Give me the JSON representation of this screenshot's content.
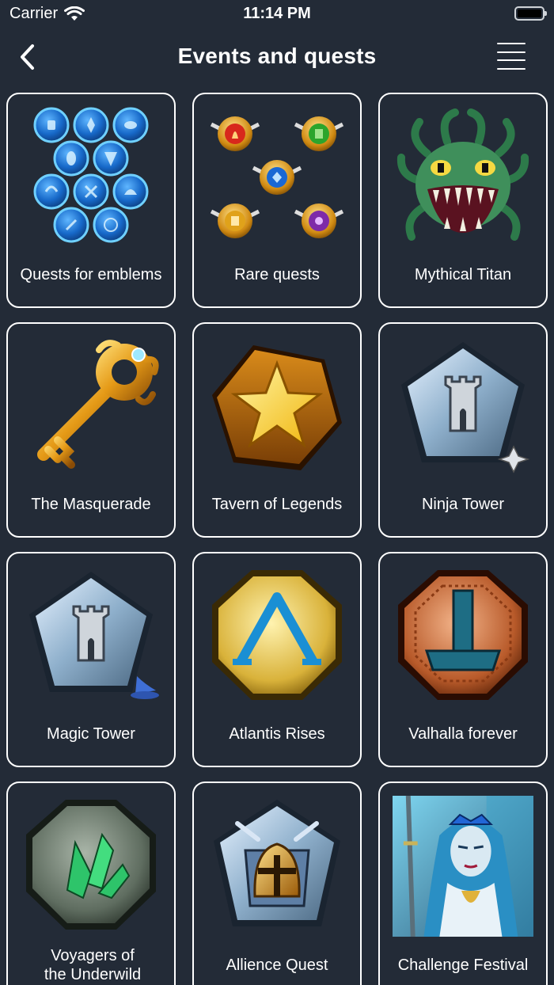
{
  "status": {
    "carrier": "Carrier",
    "time": "11:14 PM"
  },
  "nav": {
    "title": "Events and quests",
    "back_icon": "chevron-left-icon",
    "menu_icon": "hamburger-menu-icon"
  },
  "cards": [
    {
      "label": "Quests for emblems",
      "icon": "emblem-orbs-icon"
    },
    {
      "label": "Rare quests",
      "icon": "rare-shields-icon"
    },
    {
      "label": "Mythical Titan",
      "icon": "medusa-titan-icon"
    },
    {
      "label": "The Masquerade",
      "icon": "golden-key-icon"
    },
    {
      "label": "Tavern of Legends",
      "icon": "star-badge-icon"
    },
    {
      "label": "Ninja Tower",
      "icon": "ninja-tower-icon"
    },
    {
      "label": "Magic Tower",
      "icon": "magic-tower-icon"
    },
    {
      "label": "Atlantis Rises",
      "icon": "atlantis-badge-icon"
    },
    {
      "label": "Valhalla forever",
      "icon": "valhalla-hammer-icon"
    },
    {
      "label": "Voyagers of the Underwild",
      "icon": "crystal-badge-icon"
    },
    {
      "label": "Allience Quest",
      "icon": "alliance-helmet-icon"
    },
    {
      "label": "Challenge Festival",
      "icon": "ice-queen-portrait-icon"
    }
  ],
  "colors": {
    "background": "#232b37",
    "card_border": "#ffffff"
  }
}
